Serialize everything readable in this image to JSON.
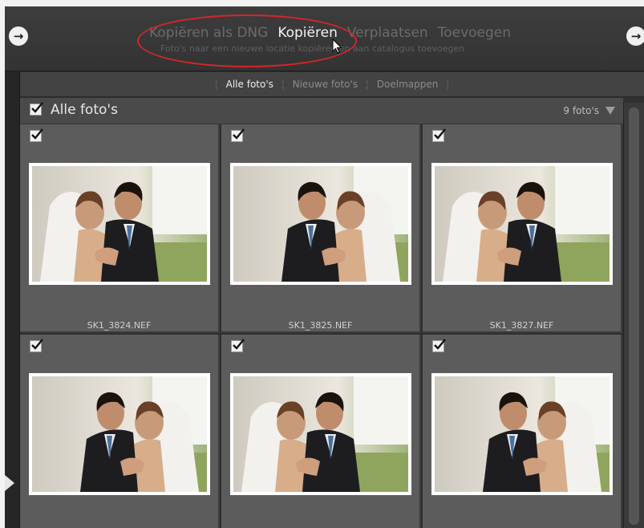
{
  "modes": {
    "items": [
      "Kopiëren als DNG",
      "Kopiëren",
      "Verplaatsen",
      "Toevoegen"
    ],
    "active_index": 1,
    "description": "Foto's naar een nieuwe locatie kopiëren en aan catalogus toevoegen"
  },
  "icons": {
    "nav_left": "arrow-right-circle-icon",
    "nav_right": "arrow-right-circle-icon",
    "cursor": "mouse-cursor-icon",
    "section_toggle": "triangle-down-icon"
  },
  "filter": {
    "tabs": [
      "Alle foto's",
      "Nieuwe foto's",
      "Doelmappen"
    ],
    "active_index": 0
  },
  "section": {
    "checked": true,
    "title": "Alle foto's",
    "count": "9 foto's"
  },
  "photos": [
    {
      "filename": "SK1_3824.NEF",
      "checked": true
    },
    {
      "filename": "SK1_3825.NEF",
      "checked": true
    },
    {
      "filename": "SK1_3827.NEF",
      "checked": true
    },
    {
      "filename": "",
      "checked": true
    },
    {
      "filename": "",
      "checked": true
    },
    {
      "filename": "",
      "checked": true
    }
  ],
  "colors": {
    "highlight": "#d4262a",
    "panel": "#2f2f2f",
    "cell": "#5c5c5c"
  }
}
